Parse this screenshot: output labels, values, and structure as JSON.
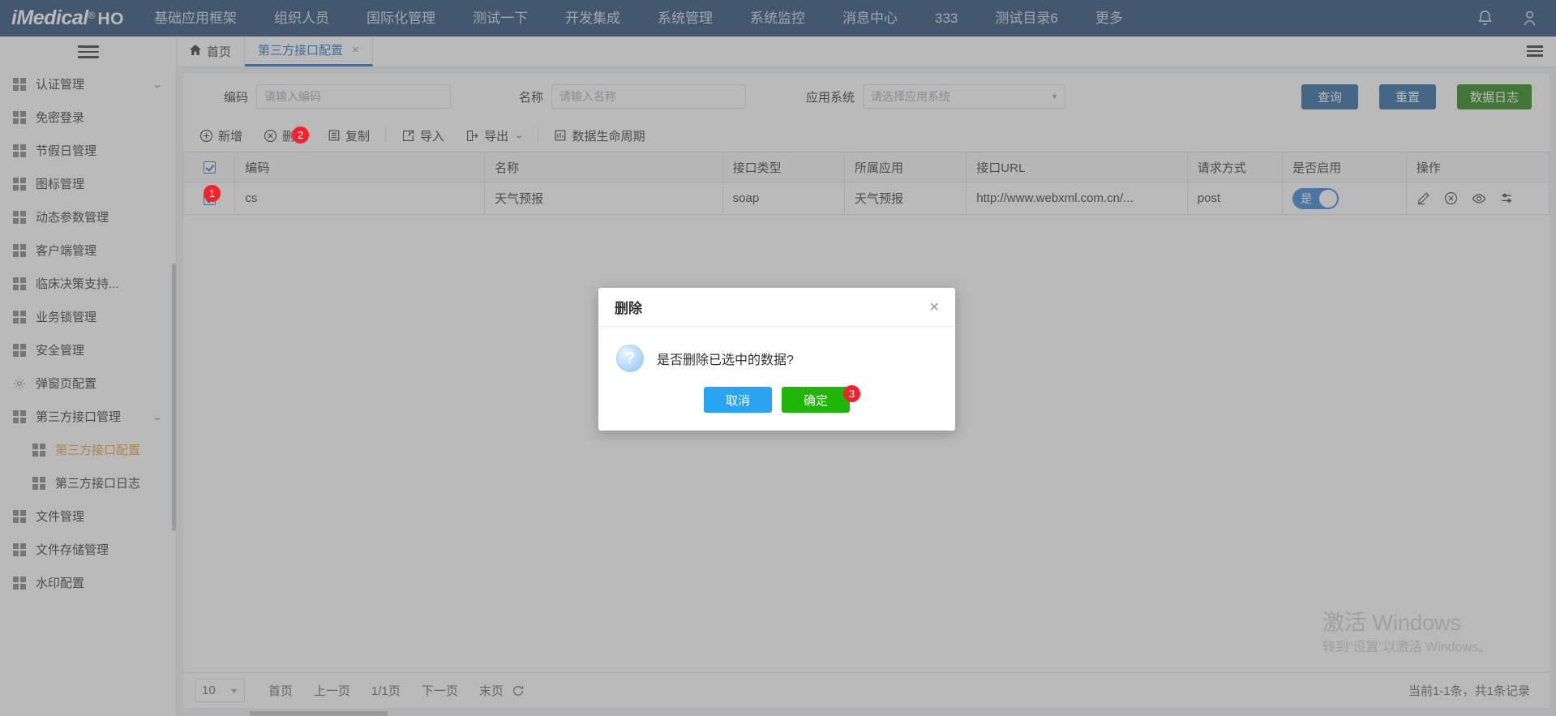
{
  "topnav": {
    "brand": {
      "name": "iMedical",
      "reg": "®",
      "suffix": "HO"
    },
    "items": [
      {
        "label": "基础应用框架"
      },
      {
        "label": "组织人员"
      },
      {
        "label": "国际化管理"
      },
      {
        "label": "测试一下"
      },
      {
        "label": "开发集成"
      },
      {
        "label": "系统管理"
      },
      {
        "label": "系统监控"
      },
      {
        "label": "消息中心"
      },
      {
        "label": "333"
      },
      {
        "label": "测试目录6"
      },
      {
        "label": "更多"
      }
    ],
    "icons": {
      "bell": "bell-icon",
      "user": "user-icon"
    }
  },
  "sidebar": {
    "items": [
      {
        "label": "认证管理",
        "icon": "grid-icon",
        "chevron": "⌄",
        "sub": false,
        "active": false
      },
      {
        "label": "免密登录",
        "icon": "grid-icon",
        "chevron": "",
        "sub": false,
        "active": false
      },
      {
        "label": "节假日管理",
        "icon": "grid-icon",
        "chevron": "",
        "sub": false,
        "active": false
      },
      {
        "label": "图标管理",
        "icon": "grid-icon",
        "chevron": "",
        "sub": false,
        "active": false
      },
      {
        "label": "动态参数管理",
        "icon": "grid-icon",
        "chevron": "",
        "sub": false,
        "active": false
      },
      {
        "label": "客户端管理",
        "icon": "grid-icon",
        "chevron": "",
        "sub": false,
        "active": false
      },
      {
        "label": "临床决策支持...",
        "icon": "grid-icon",
        "chevron": "",
        "sub": false,
        "active": false
      },
      {
        "label": "业务锁管理",
        "icon": "grid-icon",
        "chevron": "",
        "sub": false,
        "active": false
      },
      {
        "label": "安全管理",
        "icon": "grid-icon",
        "chevron": "",
        "sub": false,
        "active": false
      },
      {
        "label": "弹窗页配置",
        "icon": "gear-icon",
        "chevron": "",
        "sub": false,
        "active": false
      },
      {
        "label": "第三方接口管理",
        "icon": "grid-icon",
        "chevron": "⌄",
        "sub": false,
        "active": false
      },
      {
        "label": "第三方接口配置",
        "icon": "grid-icon",
        "chevron": "",
        "sub": true,
        "active": true
      },
      {
        "label": "第三方接口日志",
        "icon": "grid-icon",
        "chevron": "",
        "sub": true,
        "active": false
      },
      {
        "label": "文件管理",
        "icon": "grid-icon",
        "chevron": "",
        "sub": false,
        "active": false
      },
      {
        "label": "文件存储管理",
        "icon": "grid-icon",
        "chevron": "",
        "sub": false,
        "active": false
      },
      {
        "label": "水印配置",
        "icon": "grid-icon",
        "chevron": "",
        "sub": false,
        "active": false
      }
    ]
  },
  "tabs": [
    {
      "label": "首页",
      "icon": "home-icon",
      "active": false,
      "closable": false
    },
    {
      "label": "第三方接口配置",
      "icon": "",
      "active": true,
      "closable": true,
      "close": "×"
    }
  ],
  "search": {
    "code_label": "编码",
    "code_placeholder": "请输入编码",
    "code_value": "",
    "name_label": "名称",
    "name_placeholder": "请输入名称",
    "name_value": "",
    "system_label": "应用系统",
    "system_placeholder": "请选择应用系统",
    "system_value": "",
    "query_button": "查询",
    "reset_button": "重置",
    "datalog_button": "数据日志",
    "colors": {
      "primary": "#1f5f99",
      "success": "#1b7f08"
    }
  },
  "toolbar": {
    "add": "新增",
    "delete": "删除",
    "copy": "复制",
    "import": "导入",
    "export": "导出",
    "lifecycle": "数据生命周期"
  },
  "table": {
    "headers": [
      "编码",
      "名称",
      "接口类型",
      "所属应用",
      "接口URL",
      "请求方式",
      "是否启用",
      "操作"
    ],
    "header_checkbox_checked": true,
    "rows": [
      {
        "checked": true,
        "code": "cs",
        "name": "天气预报",
        "type": "soap",
        "app": "天气预报",
        "url": "http://www.webxml.com.cn/...",
        "method": "post",
        "enabled": true,
        "enabled_text": "是",
        "ops": [
          "edit-icon",
          "disable-icon",
          "view-icon",
          "config-icon"
        ]
      }
    ]
  },
  "pagination": {
    "page_size": "10",
    "first": "首页",
    "prev": "上一页",
    "current": "1/1页",
    "next": "下一页",
    "last": "末页",
    "refresh": "refresh-icon",
    "total": "当前1-1条，共1条记录"
  },
  "modal": {
    "title": "删除",
    "close": "×",
    "icon": "question-icon",
    "message": "是否删除已选中的数据?",
    "cancel": "取消",
    "confirm": "确定",
    "colors": {
      "cancel": "#2aa3f0",
      "confirm": "#21b40b"
    }
  },
  "badges": [
    {
      "num": "1",
      "where": "row-checkbox"
    },
    {
      "num": "2",
      "where": "delete-button"
    },
    {
      "num": "3",
      "where": "confirm-button"
    }
  ],
  "watermark": {
    "line1": "激活 Windows",
    "line2": "转到“设置”以激活 Windows。"
  }
}
